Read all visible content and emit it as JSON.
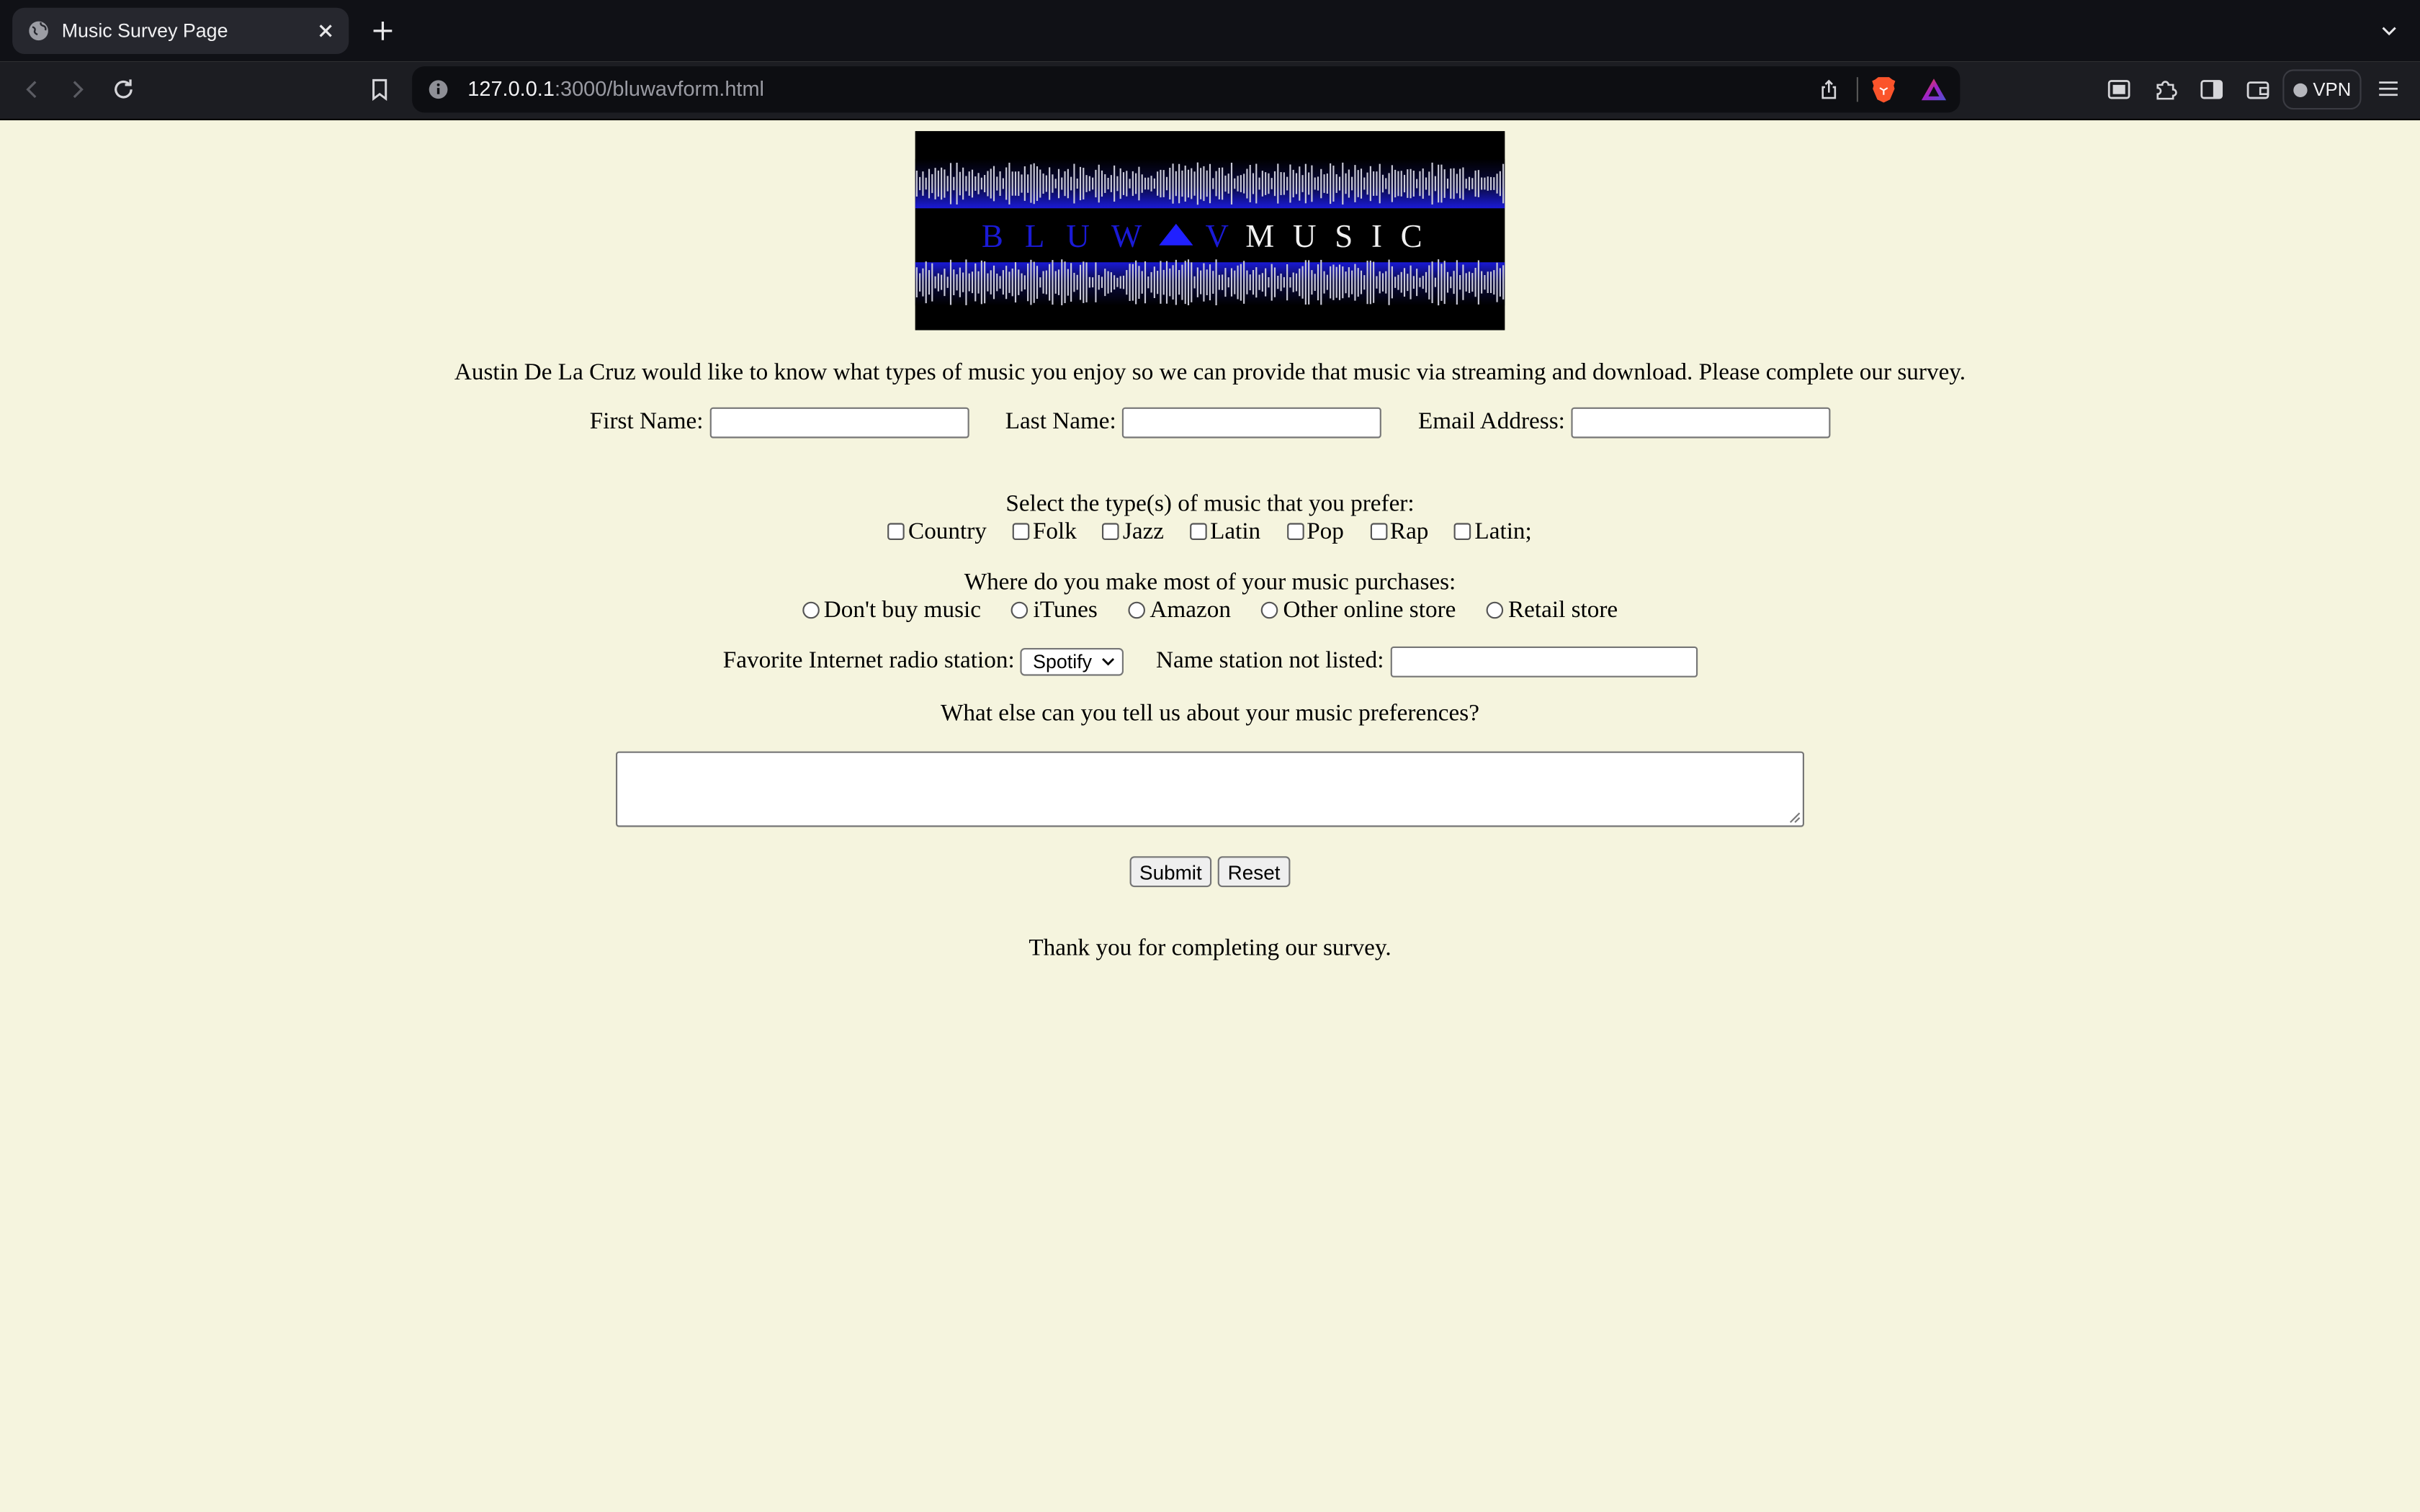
{
  "browser": {
    "tab_title": "Music Survey Page",
    "url_host": "127.0.0.1",
    "url_rest": ":3000/bluwavform.html",
    "vpn_label": "VPN",
    "icons": [
      "globe-icon",
      "close-icon",
      "plus-icon",
      "chevron-down-icon",
      "back-arrow-icon",
      "forward-arrow-icon",
      "reload-icon",
      "bookmark-icon",
      "info-icon",
      "share-icon",
      "brave-lion-icon",
      "brave-rewards-icon",
      "reader-mode-icon",
      "extensions-icon",
      "sidebar-icon",
      "wallet-icon",
      "hamburger-menu-icon"
    ]
  },
  "banner": {
    "word1": "BLUW",
    "word1_end": "V",
    "word2": "MUSIC",
    "accent_color": "#1a1ad6"
  },
  "intro": "Austin De La Cruz would like to know what types of music you enjoy so we can provide that music via streaming and download. Please complete our survey.",
  "names": {
    "first_label": "First Name:",
    "first_value": "",
    "last_label": "Last Name:",
    "last_value": "",
    "email_label": "Email Address:",
    "email_value": ""
  },
  "genres": {
    "prompt": "Select the type(s) of music that you prefer:",
    "options": [
      "Country",
      "Folk",
      "Jazz",
      "Latin",
      "Pop",
      "Rap",
      "Latin;"
    ]
  },
  "purchases": {
    "prompt": "Where do you make most of your music purchases:",
    "options": [
      "Don't buy music",
      "iTunes",
      "Amazon",
      "Other online store",
      "Retail store"
    ]
  },
  "radio": {
    "label": "Favorite Internet radio station:",
    "selected": "Spotify",
    "other_label": "Name station not listed:",
    "other_value": ""
  },
  "preferences": {
    "prompt": "What else can you tell us about your music preferences?",
    "value": ""
  },
  "buttons": {
    "submit": "Submit",
    "reset": "Reset"
  },
  "footer": "Thank you for completing our survey.",
  "colors": {
    "page_background": "#f5f4de",
    "chrome_dark": "#101116"
  }
}
